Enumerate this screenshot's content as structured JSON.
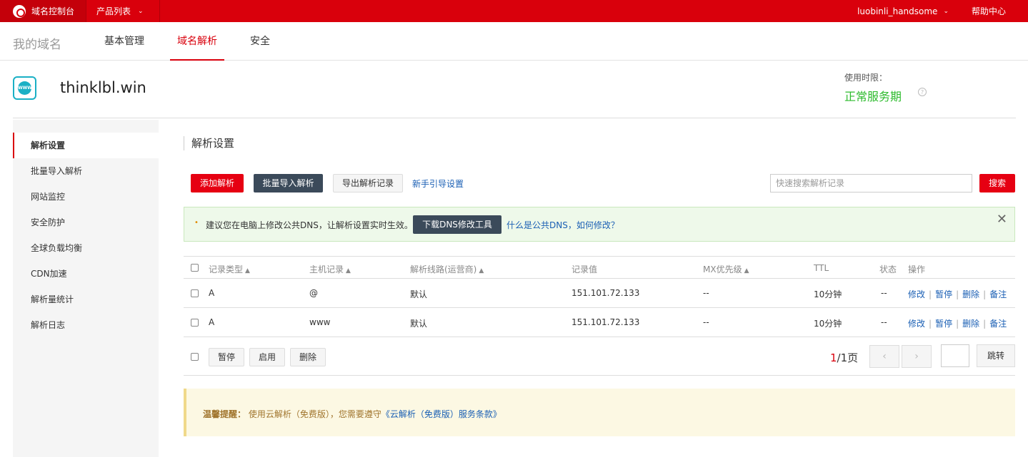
{
  "topbar": {
    "brand": "域名控制台",
    "products": "产品列表",
    "username": "luobinli_handsome",
    "help": "帮助中心"
  },
  "subnav": {
    "my_domain": "我的域名",
    "tabs": [
      "基本管理",
      "域名解析",
      "安全"
    ],
    "active_tab": "域名解析"
  },
  "domain": {
    "name": "thinklbl.win",
    "icon_text": "WWW",
    "use_label": "使用时限：",
    "use_status": "正常服务期"
  },
  "sidebar": {
    "items": [
      "解析设置",
      "批量导入解析",
      "网站监控",
      "安全防护",
      "全球负载均衡",
      "CDN加速",
      "解析量统计",
      "解析日志"
    ],
    "active": "解析设置"
  },
  "main": {
    "title": "解析设置",
    "toolbar": {
      "add": "添加解析",
      "batch_import": "批量导入解析",
      "export": "导出解析记录",
      "guide": "新手引导设置",
      "search_placeholder": "快速搜索解析记录",
      "search_btn": "搜索"
    },
    "notice": {
      "text": "建议您在电脑上修改公共DNS，让解析设置实时生效。",
      "download_btn": "下载DNS修改工具",
      "link": "什么是公共DNS，如何修改？"
    },
    "table": {
      "headers": [
        "记录类型",
        "主机记录",
        "解析线路(运营商)",
        "记录值",
        "MX优先级",
        "TTL",
        "状态",
        "操作"
      ],
      "rows": [
        {
          "type": "A",
          "host": "@",
          "line": "默认",
          "value": "151.101.72.133",
          "mx": "--",
          "ttl": "10分钟",
          "status": "--"
        },
        {
          "type": "A",
          "host": "www",
          "line": "默认",
          "value": "151.101.72.133",
          "mx": "--",
          "ttl": "10分钟",
          "status": "--"
        }
      ],
      "ops": [
        "修改",
        "暂停",
        "删除",
        "备注"
      ]
    },
    "bulk": {
      "pause": "暂停",
      "enable": "启用",
      "delete": "删除"
    },
    "pager": {
      "current": "1",
      "total": "/1页",
      "prev": "‹",
      "next": "›",
      "jump": "跳转"
    },
    "tip": {
      "label": "温馨提醒：",
      "text": "使用云解析（免费版），您需要遵守",
      "link": "《云解析（免费版）服务条款》"
    }
  }
}
